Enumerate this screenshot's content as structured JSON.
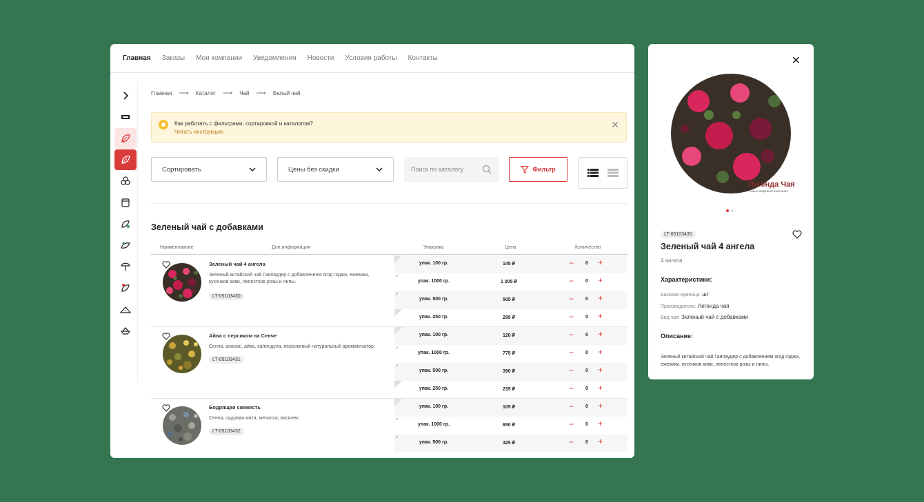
{
  "nav": [
    "Главная",
    "Заказы",
    "Мои компании",
    "Уведомления",
    "Новости",
    "Условия работы",
    "Контакты"
  ],
  "breadcrumb": [
    "Главная",
    "Каталог",
    "Чай",
    "Белый чай"
  ],
  "breadcrumb_sep": "⟶",
  "notice": {
    "text": "Как работать с фильтрами, сортировкой и каталогом?",
    "link": "Читать инструкцию"
  },
  "controls": {
    "sort": "Сортировать",
    "prices": "Цены без скидки",
    "search_placeholder": "Поиск по каталогу",
    "filter": "Фильтр"
  },
  "section_title": "Зеленый чай с добавками",
  "table_headers": [
    "Наименование",
    "Доп.информация",
    "Упаковка",
    "Цена",
    "Количество"
  ],
  "products": [
    {
      "name": "Зеленый чай 4 ангела",
      "description": "Зеленый китайский чай Ганпаудер с добавлением ягод годжи, ежевики, кусочков киви, лепестков розы и липы.",
      "sku": "LT-05103430",
      "packages": [
        {
          "pack": "упак. 100 гр.",
          "price": "145 ₽",
          "qty": "0"
        },
        {
          "pack": "упак. 1000 гр.",
          "price": "1 005 ₽",
          "qty": "0"
        },
        {
          "pack": "упак. 500 гр.",
          "price": "505 ₽",
          "qty": "0"
        },
        {
          "pack": "упак. 250 гр.",
          "price": "295 ₽",
          "qty": "0"
        }
      ]
    },
    {
      "name": "Айва с персиком на Сенче",
      "description": "Сенча, ананас, айва, календула, персиковый натуральный ароматизатор.",
      "sku": "LT-05103431",
      "packages": [
        {
          "pack": "упак. 100 гр.",
          "price": "120 ₽",
          "qty": "0"
        },
        {
          "pack": "упак. 1000 гр.",
          "price": "775 ₽",
          "qty": "0"
        },
        {
          "pack": "упак. 500 гр.",
          "price": "390 ₽",
          "qty": "0"
        },
        {
          "pack": "упак. 250 гр.",
          "price": "235 ₽",
          "qty": "0"
        }
      ]
    },
    {
      "name": "Бодрящая свежесть",
      "description": "Сенча, садовая мята, мелисса, василек.",
      "sku": "LT-05103432",
      "packages": [
        {
          "pack": "упак. 100 гр.",
          "price": "105 ₽",
          "qty": "0"
        },
        {
          "pack": "упак. 1000 гр.",
          "price": "650 ₽",
          "qty": "0"
        },
        {
          "pack": "упак. 500 гр.",
          "price": "325 ₽",
          "qty": "0"
        }
      ]
    }
  ],
  "detail": {
    "sku": "LT-05103430",
    "name": "Зеленый чай 4 ангела",
    "count": "4 ангела",
    "brand": "Легенда Чая",
    "brand_sub": "чайно-кофейная компания",
    "chars_title": "Характеристики:",
    "base_unit_label": "Базовая единица:",
    "base_unit": "шт",
    "maker_label": "Производитель:",
    "maker": "Легенда чая",
    "kind_label": "Вид чая:",
    "kind": "Зеленый чай с добавками",
    "desc_title": "Описание:",
    "description": "Зеленый китайский чай Ганпаудер с добавлением ягод годжи, ежевики, кусочков киви, лепестков розы и липы."
  },
  "colors": {
    "background": "#357651",
    "accent": "#d93a3a",
    "notice_bg": "#fdf6dd"
  }
}
